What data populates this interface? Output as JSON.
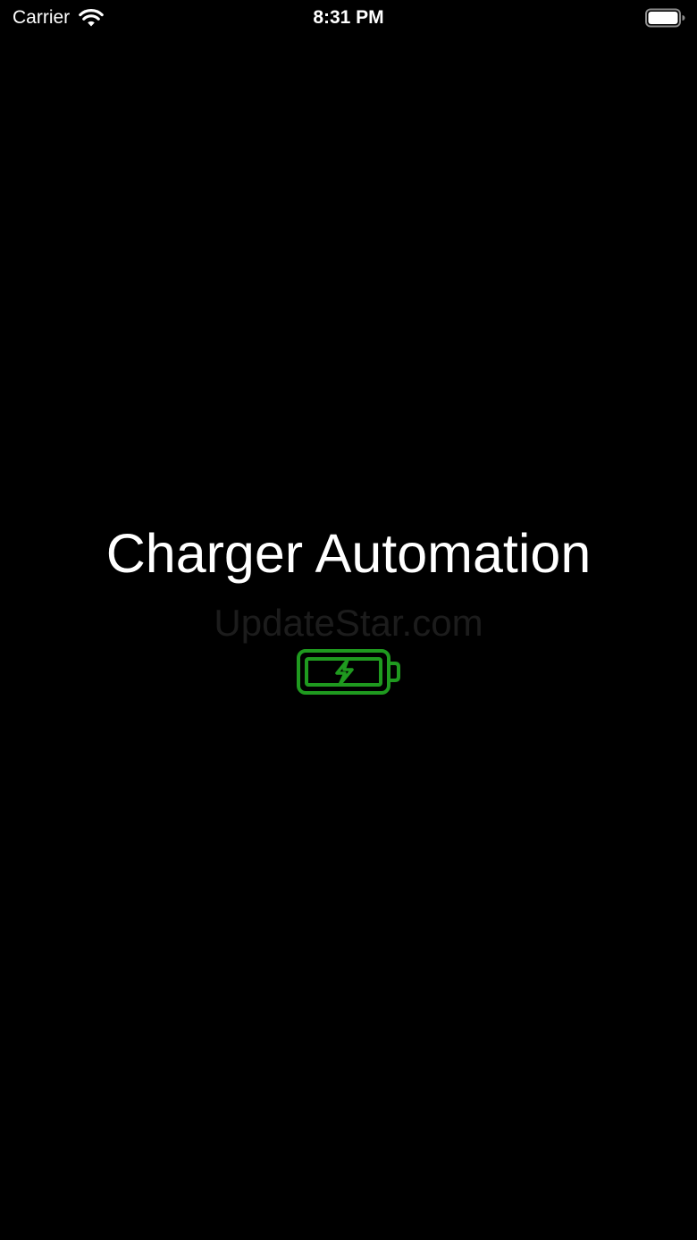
{
  "status_bar": {
    "carrier": "Carrier",
    "time": "8:31 PM",
    "wifi_icon": "wifi-icon",
    "battery_icon": "battery-full-icon"
  },
  "splash": {
    "title": "Charger Automation",
    "watermark": "UpdateStar.com",
    "icon": "battery-charging-icon"
  },
  "colors": {
    "background": "#000000",
    "text": "#ffffff",
    "accent_green": "#1f9a1f"
  }
}
